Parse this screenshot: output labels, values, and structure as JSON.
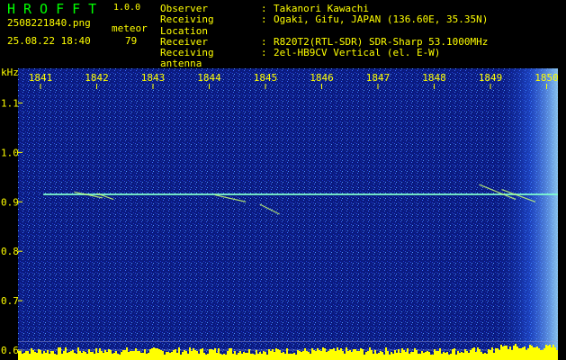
{
  "app": {
    "name": "HROFFT",
    "version": "1.0.0"
  },
  "file": {
    "name": "2508221840.png",
    "datetime": "25.08.22 18:40"
  },
  "meteor": {
    "label": "meteor",
    "count": "79"
  },
  "info": [
    {
      "key": "Observer",
      "value": "Takanori Kawachi"
    },
    {
      "key": "Receiving Location",
      "value": "Ogaki, Gifu, JAPAN (136.60E, 35.35N)"
    },
    {
      "key": "Receiver",
      "value": "R820T2(RTL-SDR) SDR-Sharp 53.1000MHz"
    },
    {
      "key": "Receiving antenna",
      "value": "2el-HB9CV Vertical (el. E-W)"
    }
  ],
  "colors": {
    "text": "#ffff00",
    "title": "#00ff00",
    "background": "#0a1a80"
  },
  "chart_data": {
    "type": "heatmap",
    "ylabel": "kHz",
    "x_ticks": [
      "1841",
      "1842",
      "1843",
      "1844",
      "1845",
      "1846",
      "1847",
      "1848",
      "1849",
      "1850"
    ],
    "x_range": [
      1840.6,
      1850.2
    ],
    "y_ticks": [
      "1.1",
      "1.0",
      "0.9",
      "0.8",
      "0.7",
      "0.6"
    ],
    "y_range": [
      0.58,
      1.17
    ],
    "carrier_khz": 0.915
  }
}
